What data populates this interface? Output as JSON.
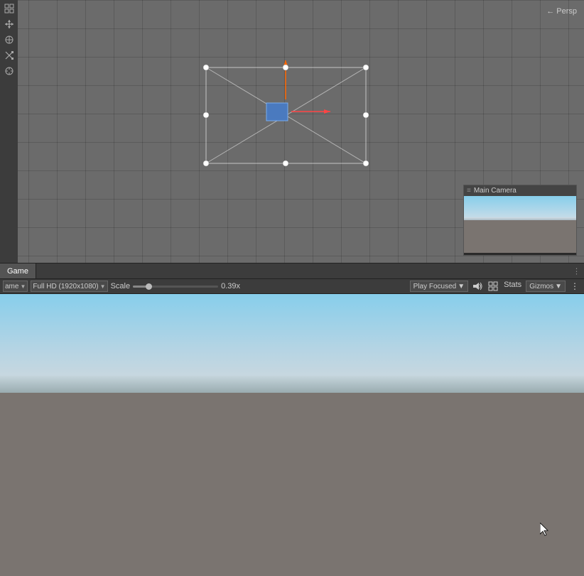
{
  "scene": {
    "persp_label": "← Persp",
    "toolbar_icons": [
      "hand",
      "move",
      "rotate",
      "scale",
      "transform"
    ],
    "camera_object": "Main Camera",
    "camera_panel_title": "Main Camera"
  },
  "tabs": {
    "game_tab": "Game",
    "scene_label_dot": "≡"
  },
  "game_toolbar": {
    "display_label": "ame",
    "resolution_label": "Full HD (1920x1080)",
    "resolution_arrow": "▼",
    "scale_label": "Scale",
    "scale_value": "0.39x",
    "play_focused_label": "Play Focused",
    "play_focused_arrow": "▼",
    "audio_icon": "🔊",
    "grid_icon": "⊞",
    "stats_label": "Stats",
    "gizmos_label": "Gizmos",
    "gizmos_arrow": "▼",
    "more_icon": "⋮"
  },
  "colors": {
    "scene_bg": "#6b6b6b",
    "toolbar_bg": "#3c3c3c",
    "tab_active_bg": "#545454",
    "panel_border": "#222222"
  }
}
